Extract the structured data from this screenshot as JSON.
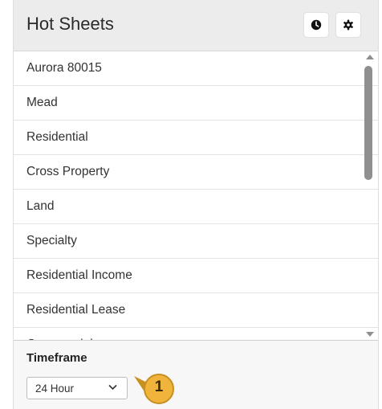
{
  "header": {
    "title": "Hot Sheets",
    "history_icon": "clock-icon",
    "settings_icon": "gear-icon"
  },
  "list": {
    "items": [
      {
        "label": "Aurora 80015"
      },
      {
        "label": "Mead"
      },
      {
        "label": "Residential"
      },
      {
        "label": "Cross Property"
      },
      {
        "label": "Land"
      },
      {
        "label": "Specialty"
      },
      {
        "label": "Residential Income"
      },
      {
        "label": "Residential Lease"
      },
      {
        "label": "Commercial"
      }
    ]
  },
  "footer": {
    "timeframe_label": "Timeframe",
    "timeframe_selected": "24 Hour",
    "callout_number": "1"
  },
  "colors": {
    "header_bg": "#ececec",
    "footer_bg": "#f7f7f7",
    "badge_gold": "#f0b43c",
    "text": "#333333"
  }
}
